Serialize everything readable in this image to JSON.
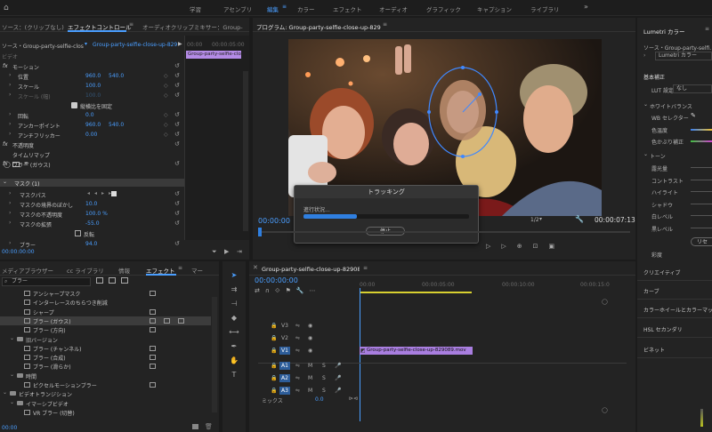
{
  "workspaces": [
    "学習",
    "アセンブリ",
    "編集",
    "カラー",
    "エフェクト",
    "オーディオ",
    "グラフィック",
    "キャプション",
    "ライブラリ"
  ],
  "active_workspace": "編集",
  "effect_controls": {
    "tabs": [
      "ソース：(クリップなし)",
      "エフェクトコントロール",
      "オーディオクリップミキサー：Group-"
    ],
    "source_label": "ソース・Group-party-selfie-close-u...",
    "clip_label": "Group-party-selfie-close-up-829...",
    "clip_bar_name": "Group-party-selfie-close",
    "ruler_start": "00:00",
    "ruler_end": "00:00:05:00",
    "section_video": "ビデオ",
    "rows": [
      {
        "label": "モーション",
        "fx": true,
        "indent": 0
      },
      {
        "label": "位置",
        "indent": 1,
        "v1": "960.0",
        "v2": "540.0"
      },
      {
        "label": "スケール",
        "indent": 1,
        "v1": "100.0"
      },
      {
        "label": "スケール (幅)",
        "indent": 1,
        "v1": "100.0",
        "dim": true
      },
      {
        "label": "縦横比を固定",
        "indent": 2,
        "checkbox": true
      },
      {
        "label": "回転",
        "indent": 1,
        "v1": "0.0"
      },
      {
        "label": "アンカーポイント",
        "indent": 1,
        "v1": "960.0",
        "v2": "540.0"
      },
      {
        "label": "アンチフリッカー",
        "indent": 1,
        "v1": "0.00"
      },
      {
        "label": "不透明度",
        "fx": true,
        "indent": 0
      },
      {
        "label": "タイムリマップ",
        "indent": 0
      },
      {
        "label": "ブラー (ガウス)",
        "fx": true,
        "indent": 0
      }
    ],
    "mask_title": "マスク (1)",
    "mask_rows": [
      {
        "label": "マスクパス"
      },
      {
        "label": "マスクの境界のぼかし",
        "v1": "10.0"
      },
      {
        "label": "マスクの不透明度",
        "v1": "100.0 %"
      },
      {
        "label": "マスクの拡張",
        "v1": "-55.0"
      },
      {
        "label": "反転",
        "checkbox": true
      },
      {
        "label": "ブラー",
        "v1": "94.0"
      }
    ],
    "timecode": "00:00:00:00"
  },
  "program": {
    "title": "プログラム: Group-party-selfie-close-up-829089",
    "timecode_left": "00:00:00",
    "timecode_right": "00:00:07:13",
    "zoom": "1/2",
    "tracking_dialog": {
      "title": "トラッキング",
      "status": "進行状況...",
      "progress": 0.32,
      "stop_label": "停止"
    }
  },
  "lumetri": {
    "title": "Lumetri カラー",
    "source": "ソース・Group-party-selfi...",
    "preset": "Lumetri カラー",
    "basic": "基本補正",
    "lut_label": "LUT 設定",
    "lut_value": "なし",
    "white_balance": "ホワイトバランス",
    "wb_selector": "WB セレクター",
    "temp": "色温度",
    "tint": "色かぶり補正",
    "tone": "トーン",
    "tone_items": [
      "露光量",
      "コントラスト",
      "ハイライト",
      "シャドウ",
      "白レベル",
      "黒レベル"
    ],
    "reset": "リセ",
    "saturation": "彩度",
    "sections": [
      "クリエイティブ",
      "カーブ",
      "カラーホイールとカラーマッチ",
      "HSL セカンダリ",
      "ビネット"
    ]
  },
  "effects_panel": {
    "tabs": [
      "メディアブラウザー",
      "cc ライブラリ",
      "情報",
      "エフェクト",
      "マー"
    ],
    "search": "ブラー",
    "items": [
      {
        "label": "アンシャープマスク",
        "indent": 2,
        "type": "clip"
      },
      {
        "label": "インターレースのちらつき削減",
        "indent": 2,
        "type": "clip"
      },
      {
        "label": "シャープ",
        "indent": 2,
        "type": "clip"
      },
      {
        "label": "ブラー (ガウス)",
        "indent": 2,
        "type": "clip",
        "selected": true
      },
      {
        "label": "ブラー (方向)",
        "indent": 2,
        "type": "clip"
      },
      {
        "label": "旧バージョン",
        "indent": 1,
        "type": "folder"
      },
      {
        "label": "ブラー (チャンネル)",
        "indent": 2,
        "type": "clip"
      },
      {
        "label": "ブラー (合成)",
        "indent": 2,
        "type": "clip"
      },
      {
        "label": "ブラー (滑らか)",
        "indent": 2,
        "type": "clip"
      },
      {
        "label": "時間",
        "indent": 1,
        "type": "folder"
      },
      {
        "label": "ピクセルモーションブラー",
        "indent": 2,
        "type": "clip"
      },
      {
        "label": "ビデオトランジション",
        "indent": 0,
        "type": "folder"
      },
      {
        "label": "イマーシブビデオ",
        "indent": 1,
        "type": "folder"
      },
      {
        "label": "VR ブラー (切替)",
        "indent": 2,
        "type": "clip"
      }
    ],
    "timecode": "00:00"
  },
  "timeline": {
    "tab": "Group-party-selfie-close-up-829089",
    "timecode": "00:00:00:00",
    "ruler": [
      "00:00",
      "00:00:05:00",
      "00:00:10:00",
      "00:00:15:0"
    ],
    "video_tracks": [
      "V3",
      "V2",
      "V1"
    ],
    "audio_tracks": [
      "A1",
      "A2",
      "A3"
    ],
    "clip_name": "Group-party-selfie-close-up-829089.mov",
    "mix_label": "ミックス",
    "mix_value": "0.0",
    "meter_db": "S S"
  }
}
